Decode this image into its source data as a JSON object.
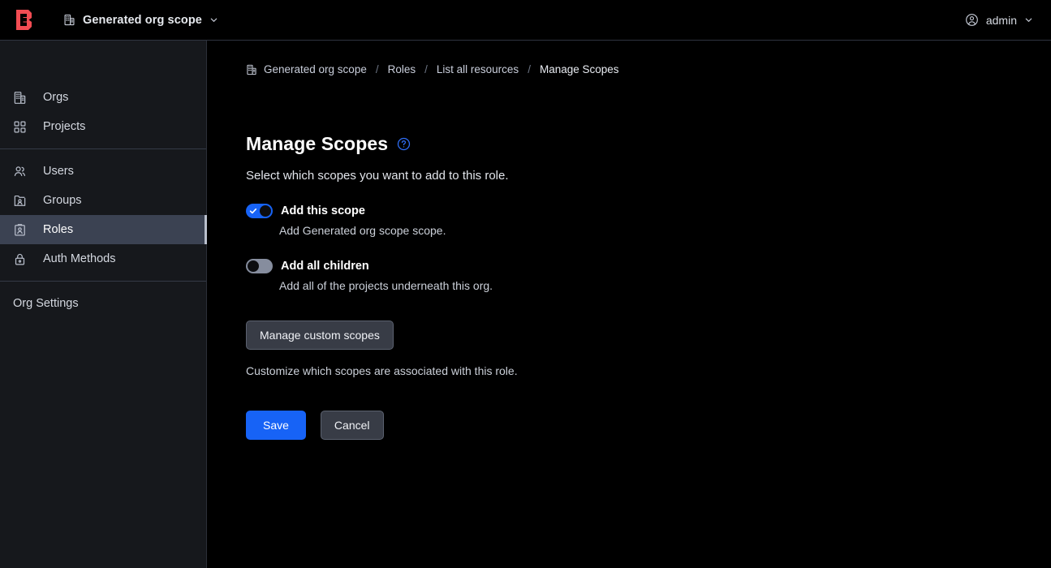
{
  "app": {
    "logo_name": "boundary-logo",
    "accent_blue": "#1763f6",
    "logo_red": "#f24c53",
    "sidebar_bg": "#16181c",
    "main_bg": "#000000",
    "active_nav_bg": "#3b4252"
  },
  "topbar": {
    "scope_icon": "org-icon",
    "scope_label": "Generated org scope",
    "scope_chevron": "chevron-down-icon",
    "user_icon": "user-circle-icon",
    "user_label": "admin",
    "user_chevron": "chevron-down-icon"
  },
  "sidebar": {
    "groups": [
      {
        "items": [
          {
            "label": "Orgs",
            "icon": "org-icon",
            "active": false
          },
          {
            "label": "Projects",
            "icon": "grid-icon",
            "active": false
          }
        ]
      },
      {
        "items": [
          {
            "label": "Users",
            "icon": "users-icon",
            "active": false
          },
          {
            "label": "Groups",
            "icon": "groups-folder-icon",
            "active": false
          },
          {
            "label": "Roles",
            "icon": "id-badge-icon",
            "active": true
          },
          {
            "label": "Auth Methods",
            "icon": "lock-icon",
            "active": false
          }
        ]
      },
      {
        "items": [
          {
            "label": "Org Settings",
            "icon": null,
            "active": false
          }
        ]
      }
    ]
  },
  "breadcrumb": {
    "icon": "org-icon",
    "separator": "/",
    "items": [
      {
        "label": "Generated org scope",
        "current": false
      },
      {
        "label": "Roles",
        "current": false
      },
      {
        "label": "List all resources",
        "current": false
      },
      {
        "label": "Manage Scopes",
        "current": true
      }
    ]
  },
  "page": {
    "title": "Manage Scopes",
    "help_icon": "question-circle-icon",
    "subtitle": "Select which scopes you want to add to this role."
  },
  "toggles": [
    {
      "name": "add-this-scope",
      "label": "Add this scope",
      "help": "Add Generated org scope scope.",
      "state": "on",
      "checked": true
    },
    {
      "name": "add-all-children",
      "label": "Add all children",
      "help": "Add all of the projects underneath this org.",
      "state": "off",
      "checked": false
    }
  ],
  "custom_scopes": {
    "button_label": "Manage custom scopes",
    "help": "Customize which scopes are associated with this role."
  },
  "actions": {
    "save_label": "Save",
    "cancel_label": "Cancel"
  }
}
